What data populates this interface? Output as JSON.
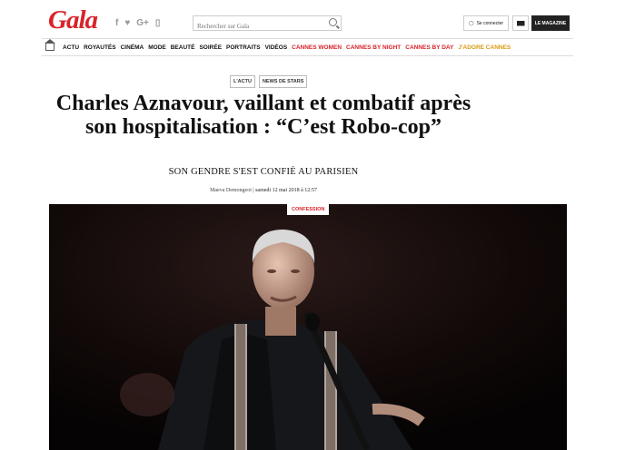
{
  "brand": {
    "logo": "Gala",
    "color": "#d8232a"
  },
  "social": [
    "f",
    "♥",
    "G+",
    "▯"
  ],
  "search": {
    "placeholder": "Rechercher sur Gala"
  },
  "header": {
    "login": "Se connecter",
    "magazine": "LE MAGAZINE"
  },
  "nav": [
    {
      "label": "ACTU",
      "style": "black"
    },
    {
      "label": "ROYAUTÉS",
      "style": "black"
    },
    {
      "label": "CINÉMA",
      "style": "black"
    },
    {
      "label": "MODE",
      "style": "black"
    },
    {
      "label": "BEAUTÉ",
      "style": "black"
    },
    {
      "label": "SOIRÉE",
      "style": "black"
    },
    {
      "label": "PORTRAITS",
      "style": "black"
    },
    {
      "label": "VIDÉOS",
      "style": "black"
    },
    {
      "label": "CANNES WOMEN",
      "style": "red"
    },
    {
      "label": "CANNES BY NIGHT",
      "style": "red"
    },
    {
      "label": "CANNES BY DAY",
      "style": "red"
    },
    {
      "label": "J'ADORE CANNES",
      "style": "gold"
    }
  ],
  "article": {
    "tags": [
      "L'ACTU",
      "NEWS DE STARS"
    ],
    "headline": "Charles Aznavour, vaillant et combatif après son hospitalisation : “C’est Robo-cop”",
    "subtitle": "SON GENDRE S'EST CONFIÉ AU PARISIEN",
    "author": "Maeva Demongeot",
    "date": "| samedi 12 mai 2018 à 12:57",
    "photo_tag": "CONFESSION"
  }
}
